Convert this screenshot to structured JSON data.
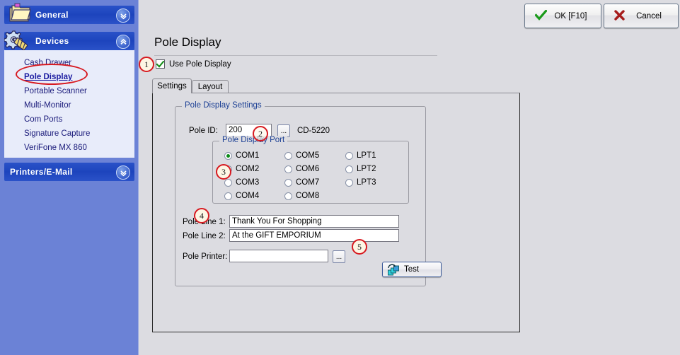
{
  "window": {
    "title": "Pole Display"
  },
  "toolbar": {
    "ok_label": "OK [F10]",
    "ok_icon": "check-icon",
    "cancel_label": "Cancel",
    "cancel_icon": "x-icon",
    "ok_color": "#1a9a1a",
    "cancel_color": "#a61c1c"
  },
  "sidebar": {
    "background_color": "#6b82d6",
    "header_color": "#2a52c8",
    "sections": [
      {
        "label": "General",
        "icon": "folder-icon",
        "expanded": false,
        "chevron": "chevron-double-down-icon"
      },
      {
        "label": "Devices",
        "icon": "gears-icon",
        "expanded": true,
        "chevron": "chevron-double-up-icon"
      },
      {
        "label": "Printers/E-Mail",
        "icon": "none",
        "expanded": false,
        "chevron": "chevron-double-down-icon"
      }
    ],
    "items": [
      {
        "label": "Cash Drawer",
        "active": false
      },
      {
        "label": "Pole Display",
        "active": true
      },
      {
        "label": "Portable Scanner",
        "active": false
      },
      {
        "label": "Multi-Monitor",
        "active": false
      },
      {
        "label": "Com Ports",
        "active": false
      },
      {
        "label": "Signature Capture",
        "active": false
      },
      {
        "label": "VeriFone MX 860",
        "active": false
      }
    ]
  },
  "page": {
    "heading": "Pole Display",
    "use_pole_display": {
      "label": "Use Pole Display",
      "checked": true
    }
  },
  "tabs": [
    {
      "label": "Settings",
      "selected": true
    },
    {
      "label": "Layout",
      "selected": false
    }
  ],
  "settings": {
    "group_title": "Pole Display Settings",
    "pole_id": {
      "label": "Pole ID:",
      "value": "200",
      "browse_label": "...",
      "model": "CD-5220"
    },
    "port_group": {
      "title": "Pole Display Port",
      "selected": "COM1",
      "columns": [
        [
          "COM1",
          "COM2",
          "COM3",
          "COM4"
        ],
        [
          "COM5",
          "COM6",
          "COM7",
          "COM8"
        ],
        [
          "LPT1",
          "LPT2",
          "LPT3"
        ]
      ]
    },
    "pole_line_1": {
      "label": "Pole Line 1:",
      "value": "Thank You For Shopping"
    },
    "pole_line_2": {
      "label": "Pole Line 2:",
      "value": "At the GIFT EMPORIUM"
    },
    "pole_printer": {
      "label": "Pole Printer:",
      "value": "",
      "browse_label": "..."
    },
    "test_button": {
      "label": "Test",
      "icon": "refresh-cascade-icon"
    }
  },
  "annotations": {
    "ellipse_target": "Pole Display",
    "callouts": [
      {
        "number": "1",
        "target": "use-pole-display-checkbox"
      },
      {
        "number": "2",
        "target": "pole-id-input"
      },
      {
        "number": "3",
        "target": "pole-display-port-group"
      },
      {
        "number": "4",
        "target": "pole-line-1-input"
      },
      {
        "number": "5",
        "target": "test-button"
      }
    ],
    "color": "#d71920"
  }
}
